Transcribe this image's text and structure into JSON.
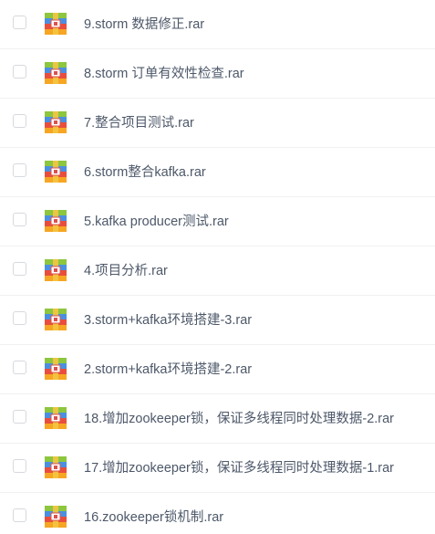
{
  "file_list": {
    "files": [
      {
        "name": "9.storm 数据修正.rar",
        "icon": "rar-archive-icon"
      },
      {
        "name": "8.storm 订单有效性检查.rar",
        "icon": "rar-archive-icon"
      },
      {
        "name": "7.整合项目测试.rar",
        "icon": "rar-archive-icon"
      },
      {
        "name": "6.storm整合kafka.rar",
        "icon": "rar-archive-icon"
      },
      {
        "name": "5.kafka producer测试.rar",
        "icon": "rar-archive-icon"
      },
      {
        "name": "4.项目分析.rar",
        "icon": "rar-archive-icon"
      },
      {
        "name": "3.storm+kafka环境搭建-3.rar",
        "icon": "rar-archive-icon"
      },
      {
        "name": "2.storm+kafka环境搭建-2.rar",
        "icon": "rar-archive-icon"
      },
      {
        "name": "18.增加zookeeper锁，保证多线程同时处理数据-2.rar",
        "icon": "rar-archive-icon"
      },
      {
        "name": "17.增加zookeeper锁，保证多线程同时处理数据-1.rar",
        "icon": "rar-archive-icon"
      },
      {
        "name": "16.zookeeper锁机制.rar",
        "icon": "rar-archive-icon"
      }
    ]
  },
  "colors": {
    "text": "#4d5869",
    "checkbox_border": "#d6d9de",
    "divider": "#f1f1f1",
    "icon_green": "#8dc63f",
    "icon_blue": "#4a90e2",
    "icon_red": "#e94e3c",
    "icon_orange": "#f6a623"
  }
}
